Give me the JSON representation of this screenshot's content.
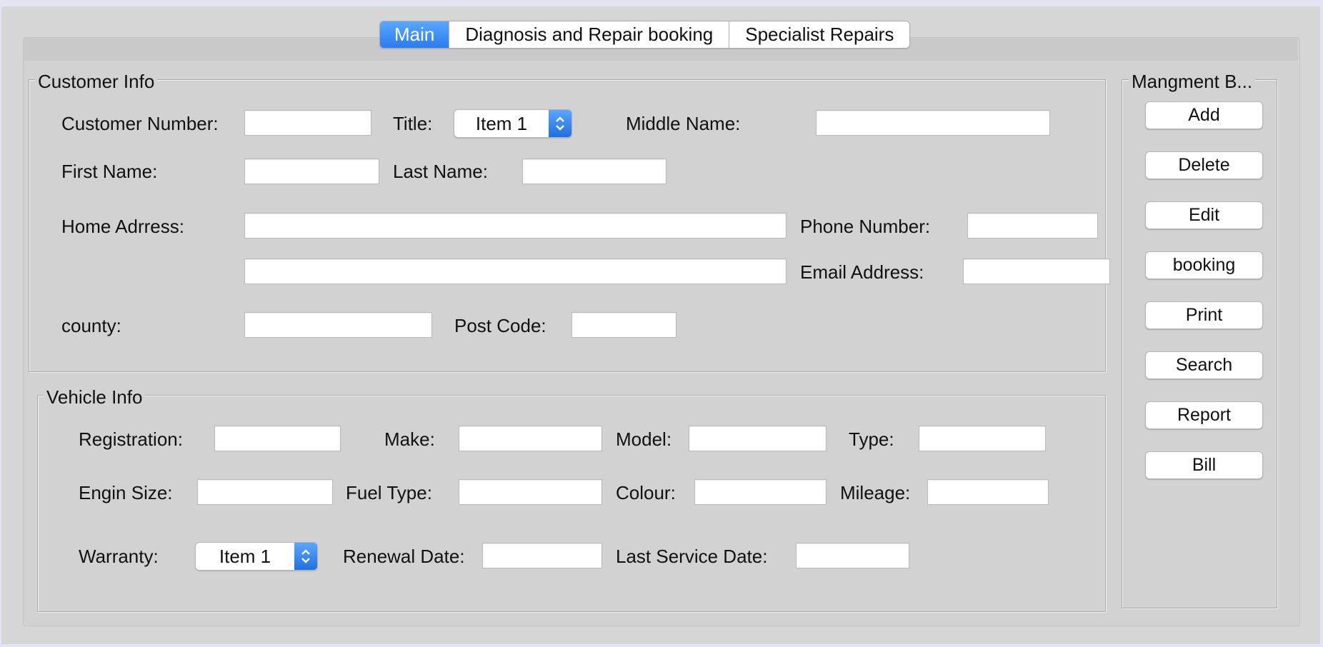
{
  "tabs": [
    "Main",
    "Diagnosis and Repair booking",
    "Specialist Repairs"
  ],
  "customer": {
    "legend": "Customer Info",
    "customer_number_label": "Customer Number:",
    "title_label": "Title:",
    "title_value": "Item 1",
    "middle_name_label": "Middle Name:",
    "first_name_label": "First Name:",
    "last_name_label": "Last Name:",
    "home_address_label": "Home Adrress:",
    "phone_label": "Phone Number:",
    "email_label": "Email Address:",
    "county_label": "county:",
    "post_code_label": "Post Code:"
  },
  "vehicle": {
    "legend": "Vehicle Info",
    "registration_label": "Registration:",
    "make_label": "Make:",
    "model_label": "Model:",
    "type_label": "Type:",
    "engine_size_label": "Engin Size:",
    "fuel_type_label": "Fuel Type:",
    "colour_label": "Colour:",
    "mileage_label": "Mileage:",
    "warranty_label": "Warranty:",
    "warranty_value": "Item 1",
    "renewal_date_label": "Renewal Date:",
    "last_service_label": "Last Service Date:"
  },
  "management": {
    "legend": "Mangment B...",
    "buttons": [
      "Add",
      "Delete",
      "Edit",
      "booking",
      "Print",
      "Search",
      "Report",
      "Bill"
    ]
  },
  "colors": {
    "accent": "#2f84f5",
    "window_bg": "#d6d6d6",
    "outer_bg": "#e4e4f4"
  },
  "icons": {
    "combo_arrows": "up-down-chevron-icon"
  }
}
